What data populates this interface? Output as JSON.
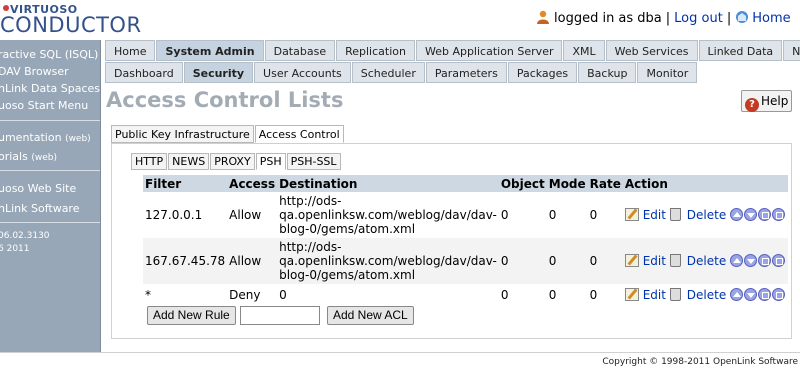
{
  "brand": {
    "top": "VIRTUOSO",
    "name": "CONDUCTOR"
  },
  "user": {
    "logged_in_text": "logged in as dba",
    "logout": "Log out",
    "home": "Home"
  },
  "sidebar": {
    "items": [
      {
        "label": "ractive SQL (ISQL)"
      },
      {
        "label": "DAV Browser"
      },
      {
        "label": "nLink Data Spaces"
      },
      {
        "label": "uoso Start Menu"
      },
      {
        "label": "umentation",
        "suffix": "(web)"
      },
      {
        "label": "orials",
        "suffix": "(web)"
      },
      {
        "label": "uoso Web Site"
      },
      {
        "label": "nLink Software"
      }
    ],
    "version": "06.02.3130",
    "date": "6 2011"
  },
  "tabs_primary": [
    "Home",
    "System Admin",
    "Database",
    "Replication",
    "Web Application Server",
    "XML",
    "Web Services",
    "Linked Data",
    "NNTP"
  ],
  "tabs_primary_active": "System Admin",
  "tabs_secondary": [
    "Dashboard",
    "Security",
    "User Accounts",
    "Scheduler",
    "Parameters",
    "Packages",
    "Backup",
    "Monitor"
  ],
  "tabs_secondary_active": "Security",
  "page_title": "Access Control Lists",
  "help_label": "Help",
  "section_tabs": [
    "Public Key Infrastructure",
    "Access Control"
  ],
  "section_active": "Access Control",
  "protocol_tabs": [
    "HTTP",
    "NEWS",
    "PROXY",
    "PSH",
    "PSH-SSL"
  ],
  "protocol_active": "PSH",
  "table": {
    "headers": [
      "Filter",
      "Access",
      "Destination",
      "Object",
      "Mode",
      "Rate",
      "Action"
    ],
    "rows": [
      {
        "filter": "127.0.0.1",
        "access": "Allow",
        "destination": "http://ods-qa.openlinksw.com/weblog/dav/dav-blog-0/gems/atom.xml",
        "object": "0",
        "mode": "0",
        "rate": "0"
      },
      {
        "filter": "167.67.45.78",
        "access": "Allow",
        "destination": "http://ods-qa.openlinksw.com/weblog/dav/dav-blog-0/gems/atom.xml",
        "object": "0",
        "mode": "0",
        "rate": "0"
      },
      {
        "filter": "*",
        "access": "Deny",
        "destination": "0",
        "object": "0",
        "mode": "0",
        "rate": "0"
      }
    ],
    "action_edit": "Edit",
    "action_delete": "Delete"
  },
  "buttons": {
    "add_rule": "Add New Rule",
    "add_acl": "Add New ACL",
    "acl_input_value": ""
  },
  "footer": "Copyright © 1998-2011 OpenLink Software"
}
